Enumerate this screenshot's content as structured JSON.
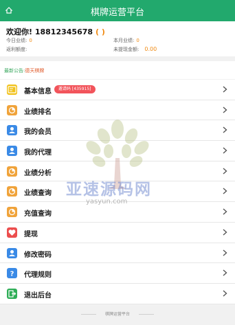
{
  "header": {
    "title": "棋牌运营平台",
    "home_icon": "home-icon"
  },
  "user": {
    "welcome": "欢迎你! 18812345678",
    "paren": "( )",
    "today_label": "今日业绩:",
    "today_value": "0",
    "month_label": "本月业绩:",
    "month_value": "0",
    "rebate_label": "返利额度:",
    "pending_label": "未提现金额:",
    "pending_value": "0.00"
  },
  "notice": {
    "label": "最新公告:",
    "text": "德天棋牌"
  },
  "menu": [
    {
      "label": "基本信息",
      "badge": "邀请码 [435915]",
      "icon": "id-card-icon",
      "color": "#f1c21b"
    },
    {
      "label": "业绩排名",
      "icon": "chart-icon",
      "color": "#f0a33a"
    },
    {
      "label": "我的会员",
      "icon": "user-icon",
      "color": "#3a8ae6"
    },
    {
      "label": "我的代理",
      "icon": "agent-icon",
      "color": "#3a8ae6"
    },
    {
      "label": "业绩分析",
      "icon": "analysis-icon",
      "color": "#f0a33a"
    },
    {
      "label": "业绩查询",
      "icon": "query-icon",
      "color": "#f0a33a"
    },
    {
      "label": "充值查询",
      "icon": "recharge-icon",
      "color": "#f0a33a"
    },
    {
      "label": "提现",
      "icon": "heart-icon",
      "color": "#ec4e4e"
    },
    {
      "label": "修改密码",
      "icon": "password-icon",
      "color": "#3a8ae6"
    },
    {
      "label": "代理规则",
      "icon": "question-icon",
      "color": "#3a8ae6"
    },
    {
      "label": "退出后台",
      "icon": "logout-icon",
      "color": "#2fae57"
    }
  ],
  "watermark": {
    "cn": "亚速源码网",
    "en": "yasyun.com"
  },
  "footer": {
    "text": "棋牌运营平台"
  }
}
